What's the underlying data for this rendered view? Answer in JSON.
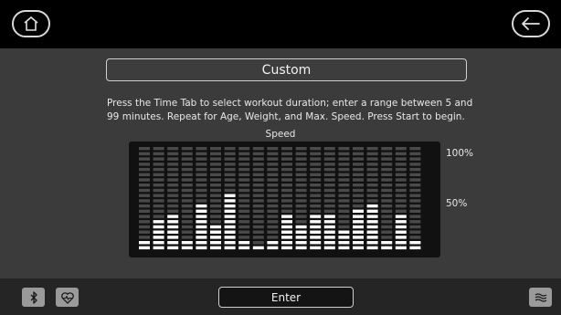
{
  "top_bar": {
    "home_icon": "home-icon",
    "back_icon": "arrow-left-icon"
  },
  "program": {
    "title": "Custom",
    "instructions": "Press the Time Tab to select workout duration; enter a range between 5 and 99 minutes. Repeat for Age, Weight, and Max. Speed. Press Start to begin."
  },
  "chart_data": {
    "type": "bar",
    "title": "Speed",
    "series": [
      {
        "name": "",
        "values": [
          12,
          28,
          33,
          12,
          46,
          26,
          57,
          12,
          6,
          10,
          33,
          23,
          33,
          33,
          20,
          40,
          43,
          12,
          33,
          12
        ]
      }
    ],
    "segments_per_column": 20,
    "ytick_labels": [
      "100%",
      "50%"
    ],
    "ylim": [
      0,
      100
    ],
    "grid": false,
    "bar_color": "#ffffff",
    "unlit_color": "#4a4a4a"
  },
  "bottom_bar": {
    "bluetooth_icon": "bluetooth-icon",
    "heart_rate_icon": "heart-rate-icon",
    "enter_label": "Enter",
    "fan_icon": "fan-icon"
  }
}
